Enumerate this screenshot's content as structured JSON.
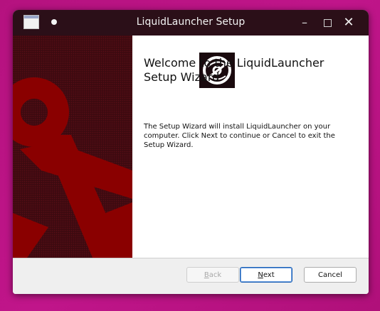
{
  "window": {
    "title": "LiquidLauncher Setup",
    "controls": {
      "minimize": "–",
      "close": "✕"
    }
  },
  "colors": {
    "desktop": "#b0107c",
    "titlebar": "#2b0f18",
    "banner_dark": "#4a0b12",
    "banner_red": "#8a0000"
  },
  "main": {
    "heading": "Welcome to the LiquidLauncher Setup Wizard",
    "body": "The Setup Wizard will install LiquidLauncher on your computer. Click Next to continue or Cancel to exit the Setup Wizard."
  },
  "buttons": {
    "back": {
      "accel": "B",
      "rest": "ack"
    },
    "next": {
      "accel": "N",
      "rest": "ext"
    },
    "cancel": "Cancel"
  },
  "icons": {
    "logo": "disc-icon",
    "app": "window-app-icon"
  }
}
